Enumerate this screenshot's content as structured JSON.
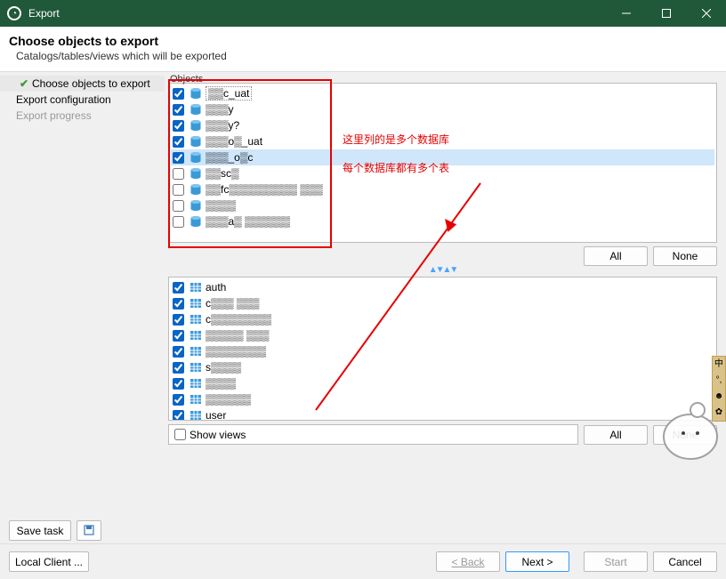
{
  "titlebar": {
    "title": "Export"
  },
  "header": {
    "title": "Choose objects to export",
    "subtitle": "Catalogs/tables/views which will be exported"
  },
  "steps": [
    {
      "label": "Choose objects to export",
      "active": true
    },
    {
      "label": "Export configuration",
      "active": false
    },
    {
      "label": "Export progress",
      "active": false,
      "disabled": true
    }
  ],
  "objects_legend": "Objects",
  "databases": [
    {
      "checked": true,
      "label": "▒▒c_uat",
      "boxed": true
    },
    {
      "checked": true,
      "label": "▒▒▒y"
    },
    {
      "checked": true,
      "label": "▒▒▒y?"
    },
    {
      "checked": true,
      "label": "▒▒▒o▒_uat"
    },
    {
      "checked": true,
      "label": "▒▒▒_o▒c",
      "selected": true
    },
    {
      "checked": false,
      "label": "▒▒sc▒"
    },
    {
      "checked": false,
      "label": "▒▒fc▒▒▒▒▒▒▒▒▒ ▒▒▒"
    },
    {
      "checked": false,
      "label": "▒▒▒▒"
    },
    {
      "checked": false,
      "label": "▒▒▒a▒ ▒▒▒▒▒▒"
    }
  ],
  "db_buttons": {
    "all": "All",
    "none": "None"
  },
  "tables": [
    {
      "checked": true,
      "label": "auth"
    },
    {
      "checked": true,
      "label": "c▒▒▒ ▒▒▒"
    },
    {
      "checked": true,
      "label": "c▒▒▒▒▒▒▒▒"
    },
    {
      "checked": true,
      "label": "▒▒▒▒▒ ▒▒▒"
    },
    {
      "checked": true,
      "label": "▒▒▒▒▒▒▒▒"
    },
    {
      "checked": true,
      "label": "s▒▒▒▒"
    },
    {
      "checked": true,
      "label": "▒▒▒▒"
    },
    {
      "checked": true,
      "label": "▒▒▒▒▒▒"
    },
    {
      "checked": true,
      "label": "user"
    }
  ],
  "show_views": {
    "label": "Show views",
    "checked": false
  },
  "tbl_buttons": {
    "all": "All",
    "none": "None"
  },
  "bottom_tools": {
    "save_task": "Save task"
  },
  "footer": {
    "local_client": "Local Client ...",
    "back": "< Back",
    "next": "Next >",
    "start": "Start",
    "cancel": "Cancel"
  },
  "annotation": {
    "line1": "这里列的是多个数据库",
    "line2": "每个数据库都有多个表"
  }
}
